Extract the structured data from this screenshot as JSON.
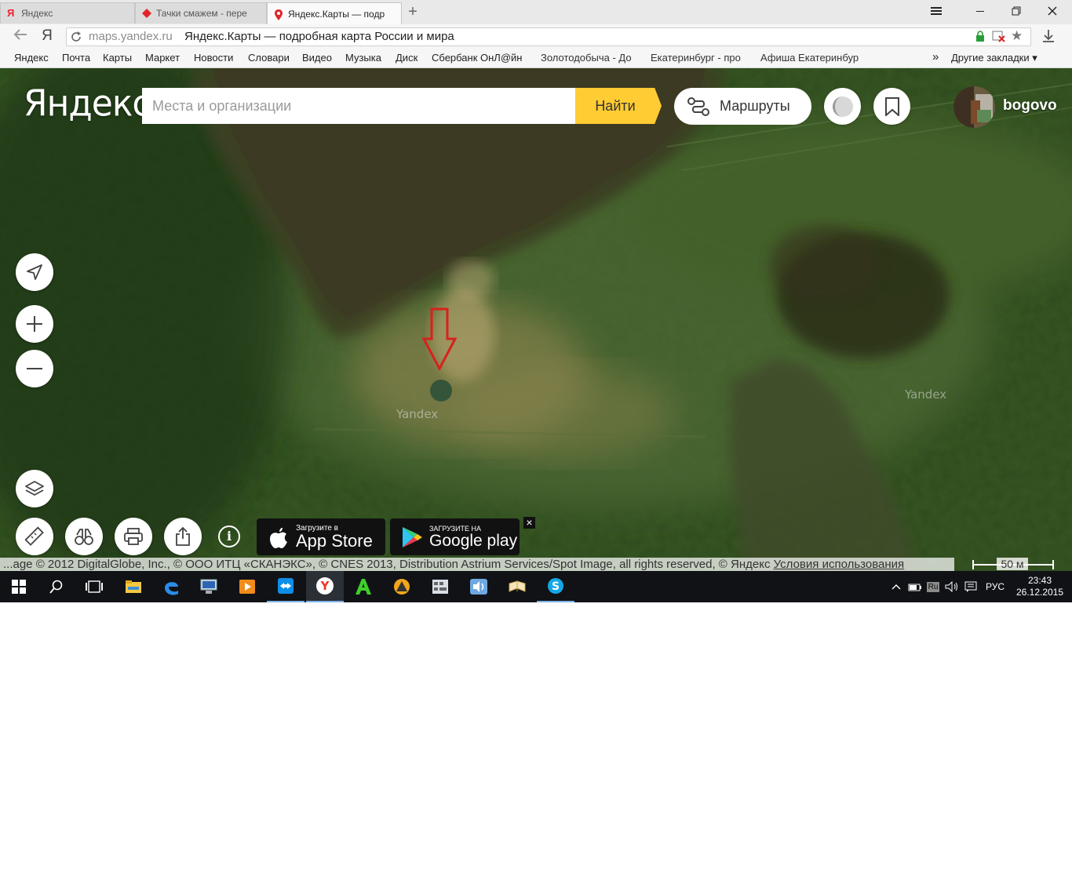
{
  "browser": {
    "tabs": [
      {
        "title": "Яндекс",
        "icon": "yandex-y-icon",
        "active": false
      },
      {
        "title": "Тачки смажем - пере",
        "icon": "red-diamond-icon",
        "active": false
      },
      {
        "title": "Яндекс.Карты — подр",
        "icon": "map-pin-icon",
        "active": true
      }
    ],
    "new_tab_label": "+",
    "window_controls": [
      "menu-icon",
      "minimize-icon",
      "restore-icon",
      "close-icon"
    ],
    "url_domain": "maps.yandex.ru",
    "url_title": "Яндекс.Карты — подробная карта России и мира",
    "yandex_button": "Я",
    "bookmarks": [
      "Яндекс",
      "Почта",
      "Карты",
      "Маркет",
      "Новости",
      "Словари",
      "Видео",
      "Музыка",
      "Диск",
      "Сбербанк ОнЛ@йн",
      "Золотодобыча - До",
      "Екатеринбург - про",
      "Афиша Екатеринбур"
    ],
    "bookmarks_overflow": "»",
    "other_bookmarks": "Другие закладки ▾"
  },
  "map": {
    "logo": "Яндекс",
    "search_placeholder": "Места и организации",
    "find_button": "Найти",
    "routes_button": "Маршруты",
    "username": "bogovo",
    "watermarks": [
      "Yandex",
      "Yandex"
    ],
    "app_store": {
      "small": "Загрузите в",
      "big": "App Store"
    },
    "google_play": {
      "small": "ЗАГРУЗИТЕ НА",
      "big": "Google play"
    },
    "store_close": "×",
    "info_icon_label": "i",
    "copyright": "...age © 2012 DigitalGlobe, Inc., © ООО ИТЦ «СКАНЭКС», © CNES 2013, Distribution Astrium Services/Spot Image, all rights reserved, © Яндекс",
    "terms_link": "Условия использования",
    "scale_label": "50 м"
  },
  "taskbar": {
    "apps": [
      "start-icon",
      "search-icon",
      "task-view-icon",
      "file-explorer-icon",
      "edge-icon",
      "network-app-icon",
      "media-player-icon",
      "teamviewer-icon",
      "yandex-browser-icon",
      "green-a-icon",
      "aimp-icon",
      "grid-app-icon",
      "sound-app-icon",
      "reader-icon",
      "skype-icon"
    ],
    "tray_lang_box": "Ru",
    "lang": "РУС",
    "time": "23:43",
    "date": "26.12.2015"
  }
}
